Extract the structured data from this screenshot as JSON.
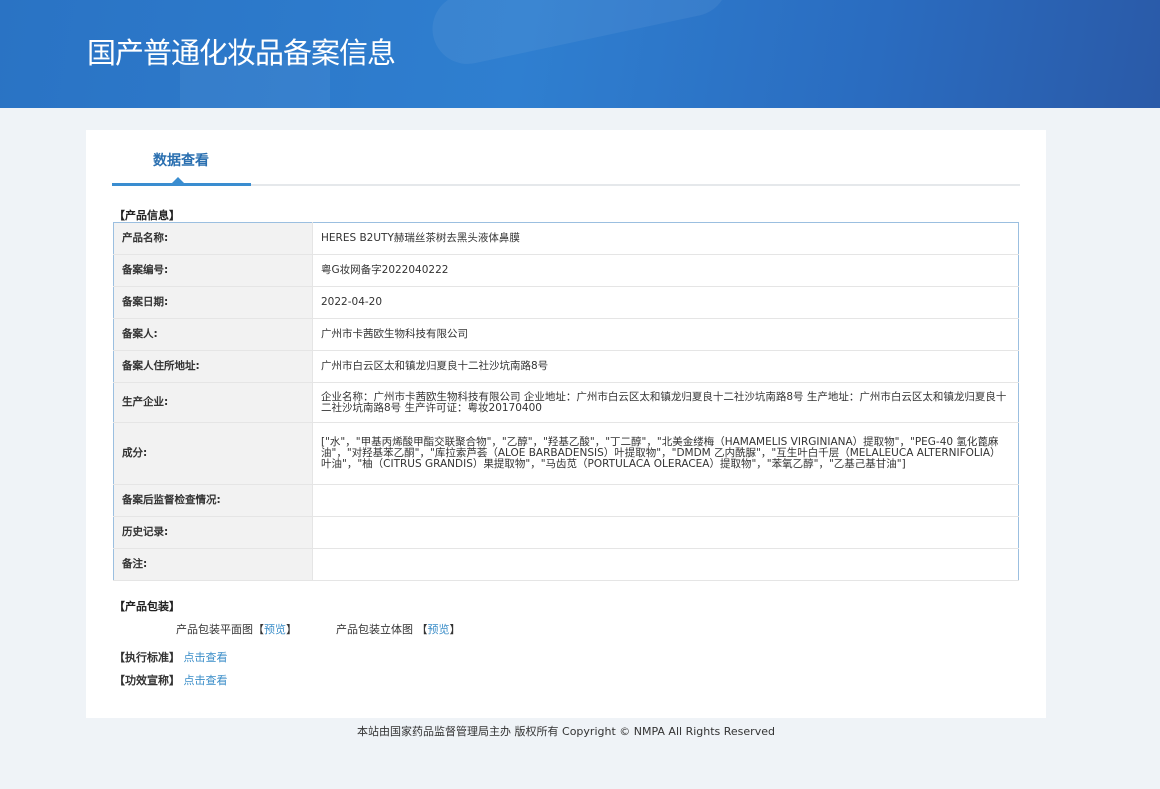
{
  "header": {
    "title": "国产普通化妆品备案信息"
  },
  "tab": {
    "label": "数据查看"
  },
  "product_info": {
    "section": "【产品信息】",
    "rows": [
      {
        "label": "产品名称:",
        "value": "HERES B2UTY赫瑞丝茶树去黑头液体鼻膜"
      },
      {
        "label": "备案编号:",
        "value": "粤G妆网备字2022040222"
      },
      {
        "label": "备案日期:",
        "value": "2022-04-20"
      },
      {
        "label": "备案人:",
        "value": "广州市卡茜欧生物科技有限公司"
      },
      {
        "label": "备案人住所地址:",
        "value": "广州市白云区太和镇龙归夏良十二社沙坑南路8号"
      },
      {
        "label": "生产企业:",
        "value": "企业名称：广州市卡茜欧生物科技有限公司 企业地址：广州市白云区太和镇龙归夏良十二社沙坑南路8号 生产地址：广州市白云区太和镇龙归夏良十二社沙坑南路8号 生产许可证：粤妆20170400"
      },
      {
        "label": "成分:",
        "value": "[\"水\"，\"甲基丙烯酸甲酯交联聚合物\"，\"乙醇\"，\"羟基乙酸\"，\"丁二醇\"，\"北美金缕梅（HAMAMELIS VIRGINIANA）提取物\"，\"PEG-40 氢化蓖麻油\"，\"对羟基苯乙酮\"，\"库拉索芦荟（ALOE BARBADENSIS）叶提取物\"，\"DMDM 乙内酰脲\"，\"互生叶白千层（MELALEUCA ALTERNIFOLIA）叶油\"，\"柚（CITRUS GRANDIS）果提取物\"，\"马齿苋（PORTULACA OLERACEA）提取物\"，\"苯氧乙醇\"，\"乙基己基甘油\"]"
      },
      {
        "label": "备案后监督检查情况:",
        "value": ""
      },
      {
        "label": "历史记录:",
        "value": ""
      },
      {
        "label": "备注:",
        "value": ""
      }
    ]
  },
  "packaging": {
    "section": "【产品包装】",
    "flat_label": "产品包装平面图",
    "solid_label": "产品包装立体图",
    "preview": "预览",
    "bracket_open": "【",
    "bracket_close": "】"
  },
  "standard": {
    "label": "【执行标准】",
    "link": "点击查看"
  },
  "claims": {
    "label": "【功效宣称】",
    "link": "点击查看"
  },
  "footer": {
    "text": "本站由国家药品监督管理局主办 版权所有 Copyright © NMPA All Rights Reserved"
  }
}
